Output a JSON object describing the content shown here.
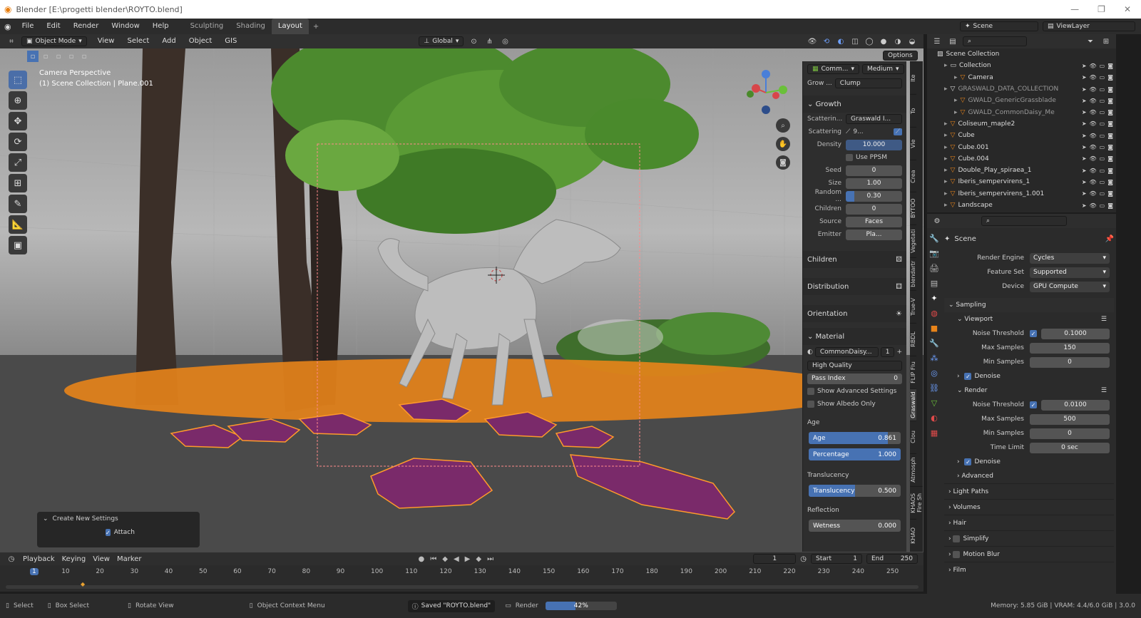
{
  "window": {
    "title": "Blender [E:\\progetti blender\\ROYTO.blend]"
  },
  "menu": [
    "File",
    "Edit",
    "Render",
    "Window",
    "Help"
  ],
  "workspaces": [
    {
      "label": "Sculpting",
      "active": false
    },
    {
      "label": "Shading",
      "active": false
    },
    {
      "label": "Layout",
      "active": true
    }
  ],
  "scene": {
    "label": "Scene",
    "view_layer": "ViewLayer"
  },
  "viewport_header": {
    "mode": "Object Mode",
    "menus": [
      "View",
      "Select",
      "Add",
      "Object",
      "GIS"
    ],
    "orientation": "Global",
    "options": "Options"
  },
  "viewport": {
    "camera_label": "Camera Perspective",
    "collection_label": "(1) Scene Collection | Plane.001",
    "gizmo_axes": [
      "Z",
      "Y",
      "X"
    ]
  },
  "redo_panel": {
    "title": "Create New Settings",
    "attach_label": "Attach",
    "attach_checked": true
  },
  "npanel": {
    "preset": "Comm...",
    "quality": "Medium",
    "grow_label": "Grow ...",
    "grow_value": "Clump",
    "growth_section": "Growth",
    "scattering_label": "Scatterin...",
    "scattering_value": "Graswald I...",
    "scattering_row": "Scattering",
    "scattering_num": "9...",
    "fields": [
      {
        "label": "Density",
        "value": "10.000"
      },
      {
        "label": "Seed",
        "value": "0"
      },
      {
        "label": "Size",
        "value": "1.00"
      },
      {
        "label": "Random ...",
        "value": "0.30"
      },
      {
        "label": "Children",
        "value": "0"
      },
      {
        "label": "Source",
        "value": "Faces"
      },
      {
        "label": "Emitter",
        "value": "Pla..."
      }
    ],
    "use_ppsm": "Use PPSM",
    "children_section": "Children",
    "distribution_section": "Distribution",
    "orientation_section": "Orientation",
    "material_section": "Material",
    "material_name": "CommonDaisy...",
    "material_users": "1",
    "quality_select": "High Quality",
    "pass_index_label": "Pass Index",
    "pass_index_value": "0",
    "show_advanced": "Show Advanced Settings",
    "show_albedo": "Show Albedo Only",
    "age_section": "Age",
    "age": {
      "label": "Age",
      "value": "0.861",
      "fraction": 0.861
    },
    "percentage": {
      "label": "Percentage",
      "value": "1.000",
      "fraction": 1.0
    },
    "translucency_section": "Translucency",
    "translucency": {
      "label": "Translucency",
      "value": "0.500",
      "fraction": 0.5
    },
    "reflection_section": "Reflection",
    "wetness": {
      "label": "Wetness",
      "value": "0.000",
      "fraction": 0.0
    }
  },
  "side_tabs": [
    "Ite",
    "To",
    "Vie",
    "Crea",
    "BYTOO",
    "Vegetati",
    "blendartr",
    "True-V",
    "RBDL",
    "FLIP Flu",
    "Graswald",
    "Clou",
    "Atmosph",
    "KHAOS Fire Sh",
    "KHAO"
  ],
  "outliner": {
    "root": "Scene Collection",
    "items": [
      {
        "label": "Collection",
        "indent": 1
      },
      {
        "label": "Camera",
        "indent": 2
      },
      {
        "label": "GRASWALD_DATA_COLLECTION",
        "indent": 1
      },
      {
        "label": "GWALD_GenericGrassblade",
        "indent": 2
      },
      {
        "label": "GWALD_CommonDaisy_Me",
        "indent": 2
      },
      {
        "label": "Coliseum_maple2",
        "indent": 1
      },
      {
        "label": "Cube",
        "indent": 1
      },
      {
        "label": "Cube.001",
        "indent": 1
      },
      {
        "label": "Cube.004",
        "indent": 1
      },
      {
        "label": "Double_Play_spiraea_1",
        "indent": 1
      },
      {
        "label": "Iberis_sempervirens_1",
        "indent": 1
      },
      {
        "label": "Iberis_sempervirens_1.001",
        "indent": 1
      },
      {
        "label": "Landscape",
        "indent": 1
      }
    ]
  },
  "properties": {
    "context": "Scene",
    "render_engine_label": "Render Engine",
    "render_engine": "Cycles",
    "feature_set_label": "Feature Set",
    "feature_set": "Supported",
    "device_label": "Device",
    "device": "GPU Compute",
    "sampling": "Sampling",
    "viewport": "Viewport",
    "vp_noise_label": "Noise Threshold",
    "vp_noise": "0.1000",
    "vp_max_label": "Max Samples",
    "vp_max": "150",
    "vp_min_label": "Min Samples",
    "vp_min": "0",
    "denoise": "Denoise",
    "render": "Render",
    "r_noise": "0.0100",
    "r_max": "500",
    "r_min": "0",
    "time_limit_label": "Time Limit",
    "time_limit": "0 sec",
    "advanced": "Advanced",
    "panels": [
      "Light Paths",
      "Volumes",
      "Hair",
      "Simplify",
      "Motion Blur",
      "Film"
    ]
  },
  "timeline": {
    "menus": [
      "Playback",
      "Keying",
      "View",
      "Marker"
    ],
    "current_frame": "1",
    "start_label": "Start",
    "start": "1",
    "end_label": "End",
    "end": "250",
    "ticks": [
      "1",
      "10",
      "20",
      "30",
      "40",
      "50",
      "60",
      "70",
      "80",
      "90",
      "100",
      "110",
      "120",
      "130",
      "140",
      "150",
      "160",
      "170",
      "180",
      "190",
      "200",
      "210",
      "220",
      "230",
      "240",
      "250"
    ]
  },
  "status": {
    "select": "Select",
    "box_select": "Box Select",
    "rotate": "Rotate View",
    "context_menu": "Object Context Menu",
    "saved": "Saved \"ROYTO.blend\"",
    "render_label": "Render",
    "render_progress": "42%",
    "render_fraction": 0.42,
    "memory": "Memory: 5.85 GiB | VRAM: 4.4/6.0 GiB | 3.0.0"
  },
  "colors": {
    "accent": "#4772b3",
    "selection": "#ff8c1a",
    "purple": "#7a2a6a"
  }
}
